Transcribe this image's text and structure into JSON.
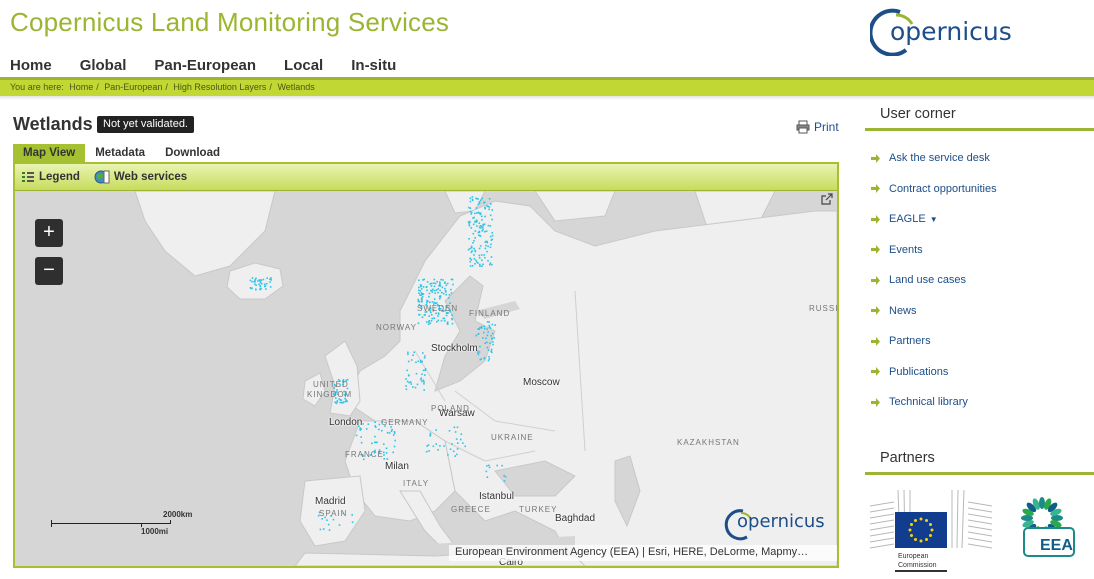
{
  "header": {
    "site_title": "Copernicus Land Monitoring Services",
    "logo_text": "opernicus"
  },
  "nav": [
    "Home",
    "Global",
    "Pan-European",
    "Local",
    "In-situ"
  ],
  "breadcrumb": {
    "prefix": "You are here:",
    "items": [
      "Home",
      "Pan-European",
      "High Resolution Layers",
      "Wetlands"
    ]
  },
  "main": {
    "title": "Wetlands",
    "badge": "Not yet validated.",
    "print_label": "Print",
    "tabs": [
      "Map View",
      "Metadata",
      "Download"
    ],
    "active_tab": "Map View",
    "toolbar": {
      "legend": "Legend",
      "web_services": "Web services"
    }
  },
  "map": {
    "zoom_in": "+",
    "zoom_out": "−",
    "scale_km": "2000km",
    "scale_mi": "1000mi",
    "attribution": "European Environment Agency (EEA) | Esri, HERE, DeLorme, Mapmy…",
    "logo_text": "opernicus",
    "labels": {
      "stockholm": "Stockholm",
      "moscow": "Moscow",
      "london": "London",
      "warsaw": "Warsaw",
      "milan": "Milan",
      "madrid": "Madrid",
      "istanbul": "Istanbul",
      "baghdad": "Baghdad",
      "cairo": "Cairo",
      "finland": "FINLAND",
      "sweden": "SWEDEN",
      "norway": "NORWAY",
      "russia": "RUSSIA",
      "uk_1": "UNITED",
      "uk_2": "KINGDOM",
      "germany": "GERMANY",
      "poland": "POLAND",
      "ukraine": "UKRAINE",
      "kazakhstan": "KAZAKHSTAN",
      "france": "FRANCE",
      "italy": "ITALY",
      "spain": "SPAIN",
      "greece": "GREECE",
      "turkey": "TURKEY"
    },
    "colors": {
      "wetland_points": "#2ec4e6",
      "land": "#efefef",
      "water": "#d6d6d6"
    }
  },
  "sidebar": {
    "user_corner_heading": "User corner",
    "items": [
      "Ask the service desk",
      "Contract opportunities",
      "EAGLE",
      "Events",
      "Land use cases",
      "News",
      "Partners",
      "Publications",
      "Technical library"
    ],
    "partners_heading": "Partners",
    "ec_label_1": "European",
    "ec_label_2": "Commission",
    "eea_label": "EEA"
  },
  "colors": {
    "brand_green": "#9bb532",
    "link_blue": "#1d4e89",
    "bar_green": "#c0d734"
  }
}
